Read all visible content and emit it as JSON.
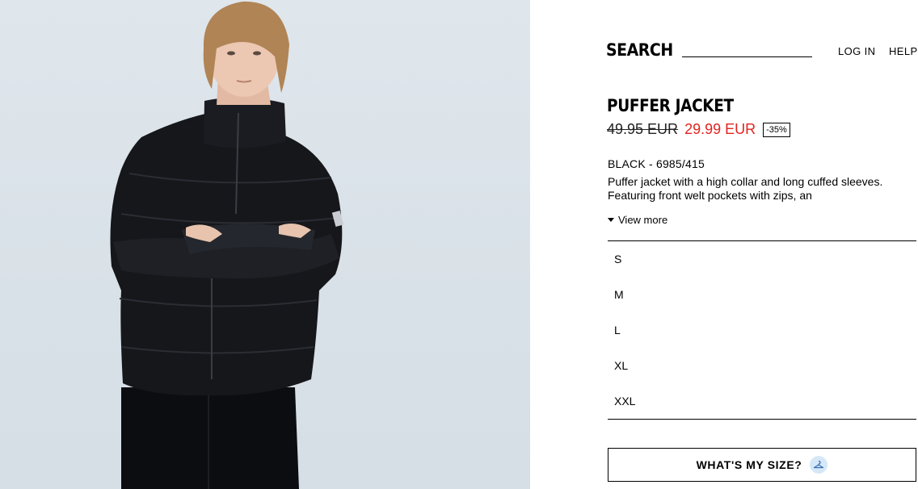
{
  "header": {
    "search_label": "SEARCH",
    "login_label": "LOG IN",
    "help_label": "HELP"
  },
  "product": {
    "title": "PUFFER JACKET",
    "old_price": "49.95 EUR",
    "new_price": "29.99 EUR",
    "discount": "-35%",
    "color_ref": "BLACK - 6985/415",
    "description": "Puffer jacket with a high collar and long cuffed sleeves. Featuring front welt pockets with zips, an",
    "view_more_label": "View more",
    "image_icon": "model-photo"
  },
  "sizes": [
    "S",
    "M",
    "L",
    "XL",
    "XXL"
  ],
  "size_guide": {
    "label": "WHAT'S MY SIZE?",
    "icon": "hanger-icon"
  },
  "colors": {
    "sale_price": "#e3231f",
    "image_background": "#dce4eb",
    "hanger_badge": "#d6e8f7"
  }
}
